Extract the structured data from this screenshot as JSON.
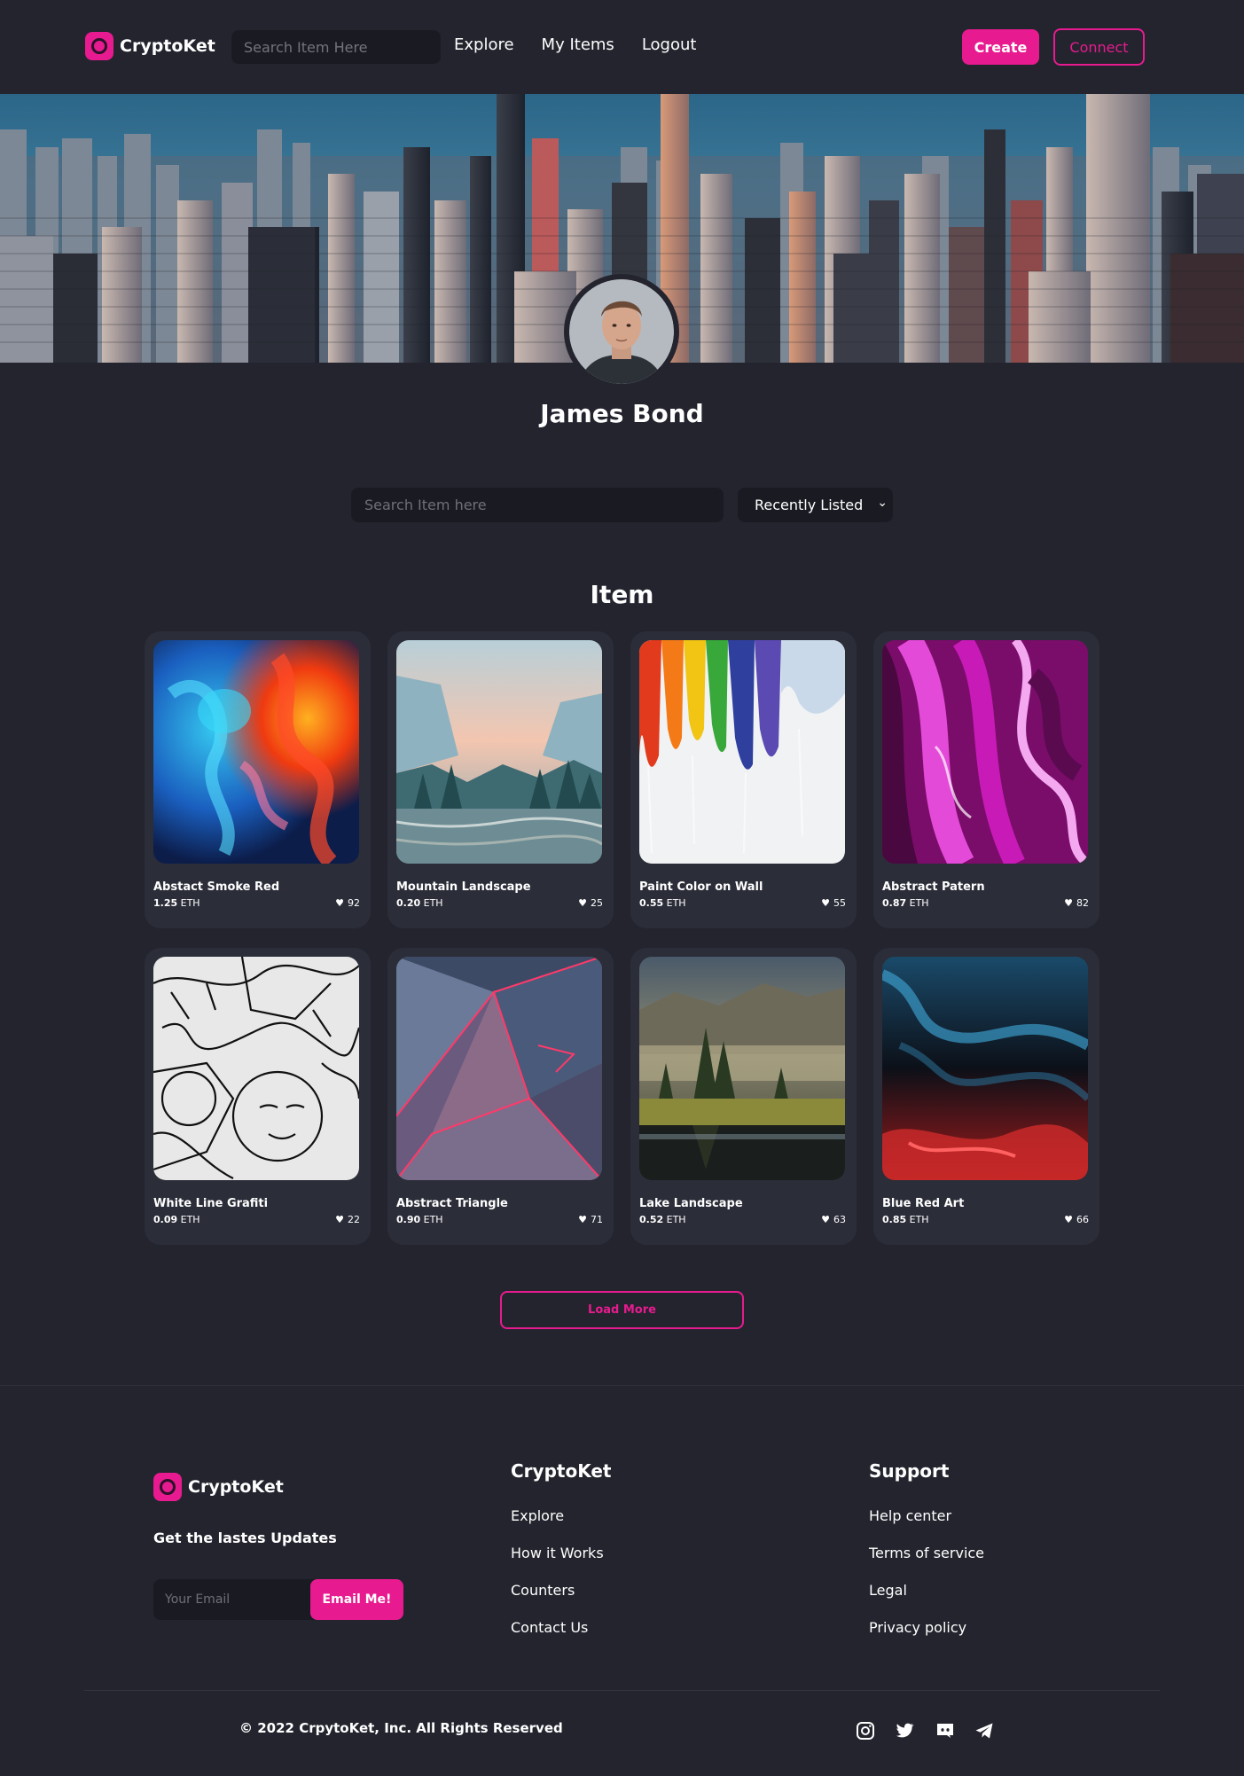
{
  "brand": {
    "name": "CryptoKet",
    "accent": "#e71b8f"
  },
  "nav": {
    "search_placeholder": "Search Item Here",
    "links": [
      "Explore",
      "My Items",
      "Logout"
    ],
    "create_label": "Create",
    "connect_label": "Connect"
  },
  "profile": {
    "name": "James Bond"
  },
  "filter": {
    "search_placeholder": "Search Item here",
    "sort_selected": "Recently Listed"
  },
  "section_title": "Item",
  "items": [
    {
      "name": "Abstact Smoke Red",
      "price": "1.25",
      "unit": "ETH",
      "likes": "92"
    },
    {
      "name": "Mountain Landscape",
      "price": "0.20",
      "unit": "ETH",
      "likes": "25"
    },
    {
      "name": "Paint Color on Wall",
      "price": "0.55",
      "unit": "ETH",
      "likes": "55"
    },
    {
      "name": "Abstract Patern",
      "price": "0.87",
      "unit": "ETH",
      "likes": "82"
    },
    {
      "name": "White Line Grafiti",
      "price": "0.09",
      "unit": "ETH",
      "likes": "22"
    },
    {
      "name": "Abstract Triangle",
      "price": "0.90",
      "unit": "ETH",
      "likes": "71"
    },
    {
      "name": "Lake Landscape",
      "price": "0.52",
      "unit": "ETH",
      "likes": "63"
    },
    {
      "name": "Blue Red Art",
      "price": "0.85",
      "unit": "ETH",
      "likes": "66"
    }
  ],
  "load_more_label": "Load More",
  "footer": {
    "updates_label": "Get the lastes Updates",
    "email_placeholder": "Your Email",
    "email_button": "Email Me!",
    "col1": {
      "title": "CryptoKet",
      "links": [
        "Explore",
        "How it Works",
        "Counters",
        "Contact Us"
      ]
    },
    "col2": {
      "title": "Support",
      "links": [
        "Help center",
        "Terms of service",
        "Legal",
        "Privacy policy"
      ]
    },
    "copyright": "© 2022 CrpytoKet, Inc. All Rights Reserved",
    "social_icons": [
      "instagram-icon",
      "twitter-icon",
      "discord-icon",
      "telegram-icon"
    ]
  }
}
